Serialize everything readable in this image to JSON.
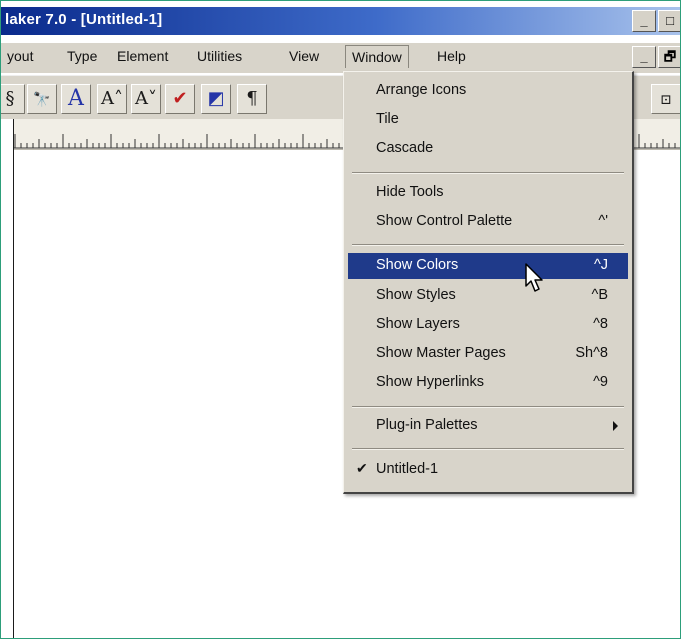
{
  "window": {
    "title": "laker 7.0 - [Untitled-1]",
    "min_glyph": "_",
    "max_glyph": "□",
    "mdi_min_glyph": "_",
    "mdi_restore_glyph": "🗗"
  },
  "menubar": {
    "items": [
      "yout",
      "Type",
      "Element",
      "Utilities",
      "View",
      "Window",
      "Help"
    ],
    "active": "Window"
  },
  "toolbar": {
    "buttons": [
      "§",
      "🔭",
      "A",
      "A˄",
      "A˅",
      "✔",
      "◩",
      "¶",
      "⊡"
    ]
  },
  "window_menu": {
    "items": [
      {
        "label": "Arrange Icons",
        "shortcut": ""
      },
      {
        "label": "Tile",
        "shortcut": ""
      },
      {
        "label": "Cascade",
        "shortcut": ""
      },
      {
        "label": "Hide Tools",
        "shortcut": ""
      },
      {
        "label": "Show Control Palette",
        "shortcut": "^'"
      },
      {
        "label": "Show Colors",
        "shortcut": "^J"
      },
      {
        "label": "Show Styles",
        "shortcut": "^B"
      },
      {
        "label": "Show Layers",
        "shortcut": "^8"
      },
      {
        "label": "Show Master Pages",
        "shortcut": "Sh^8"
      },
      {
        "label": "Show Hyperlinks",
        "shortcut": "^9"
      },
      {
        "label": "Plug-in Palettes",
        "shortcut": ""
      },
      {
        "label": "Untitled-1",
        "shortcut": ""
      }
    ],
    "highlighted": "Show Colors",
    "checked": "Untitled-1"
  },
  "colors": {
    "selection": "#1f3a8a",
    "titlebar_start": "#0a2a8c",
    "chrome": "#d8d4ca"
  }
}
